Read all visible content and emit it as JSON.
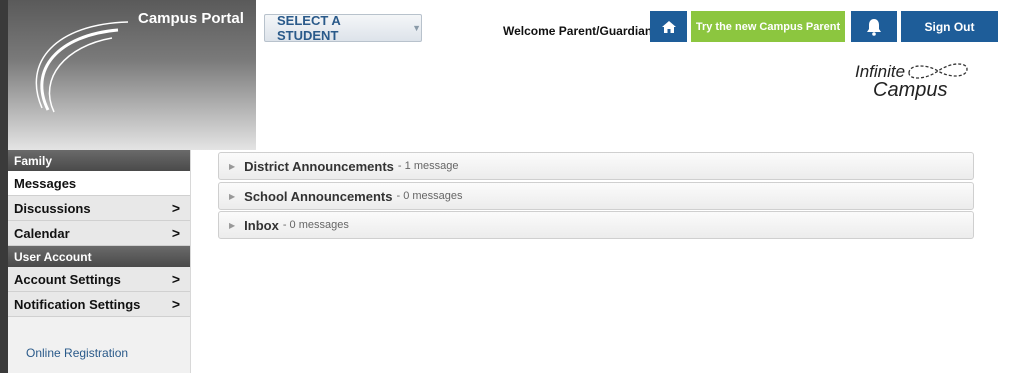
{
  "header": {
    "portal_title": "Campus Portal",
    "student_select": "SELECT A STUDENT",
    "welcome": "Welcome Parent/Guardian",
    "try_button": "Try the new Campus Parent",
    "sign_out": "Sign Out",
    "colors": {
      "primary": "#1e5d99",
      "accent": "#8cc63f"
    }
  },
  "logo": {
    "line1": "Infinite",
    "line2": "Campus"
  },
  "sidebar": {
    "sections": [
      {
        "title": "Family",
        "items": [
          {
            "label": "Messages",
            "chevron": ""
          },
          {
            "label": "Discussions",
            "chevron": ">"
          },
          {
            "label": "Calendar",
            "chevron": ">"
          }
        ]
      },
      {
        "title": "User Account",
        "items": [
          {
            "label": "Account Settings",
            "chevron": ">"
          },
          {
            "label": "Notification Settings",
            "chevron": ">"
          }
        ]
      }
    ],
    "online_registration": "Online Registration"
  },
  "messages": [
    {
      "title": "District Announcements",
      "count": "- 1 message"
    },
    {
      "title": "School Announcements",
      "count": "- 0 messages"
    },
    {
      "title": "Inbox",
      "count": "- 0 messages"
    }
  ]
}
